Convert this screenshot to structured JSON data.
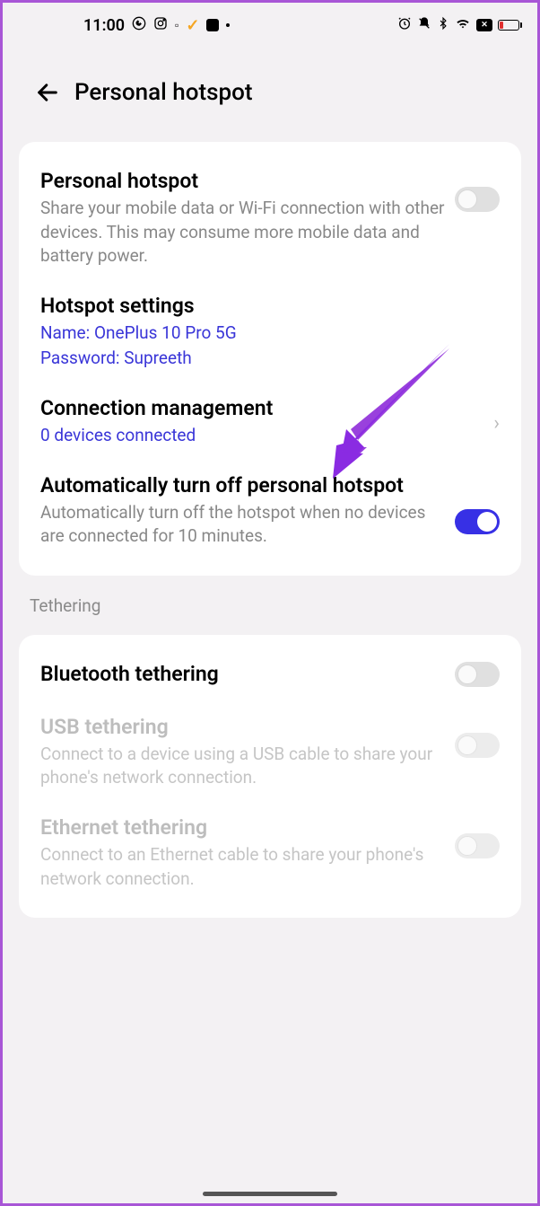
{
  "status": {
    "time": "11:00"
  },
  "header": {
    "title": "Personal hotspot"
  },
  "settings": {
    "hotspot": {
      "title": "Personal hotspot",
      "desc": "Share your mobile data or Wi-Fi connection with other devices. This may consume more mobile data and battery power."
    },
    "hotspot_settings": {
      "title": "Hotspot settings",
      "name_line": "Name: OnePlus 10 Pro 5G",
      "password_line": "Password: Supreeth"
    },
    "connection_mgmt": {
      "title": "Connection management",
      "subtitle": "0 devices connected"
    },
    "auto_off": {
      "title": "Automatically turn off personal hotspot",
      "desc": "Automatically turn off the hotspot when no devices are connected for 10 minutes."
    }
  },
  "tethering": {
    "section_label": "Tethering",
    "bluetooth": {
      "title": "Bluetooth tethering"
    },
    "usb": {
      "title": "USB tethering",
      "desc": "Connect to a device using a USB cable to share your phone's network connection."
    },
    "ethernet": {
      "title": "Ethernet tethering",
      "desc": "Connect to an Ethernet cable to share your phone's network connection."
    }
  }
}
